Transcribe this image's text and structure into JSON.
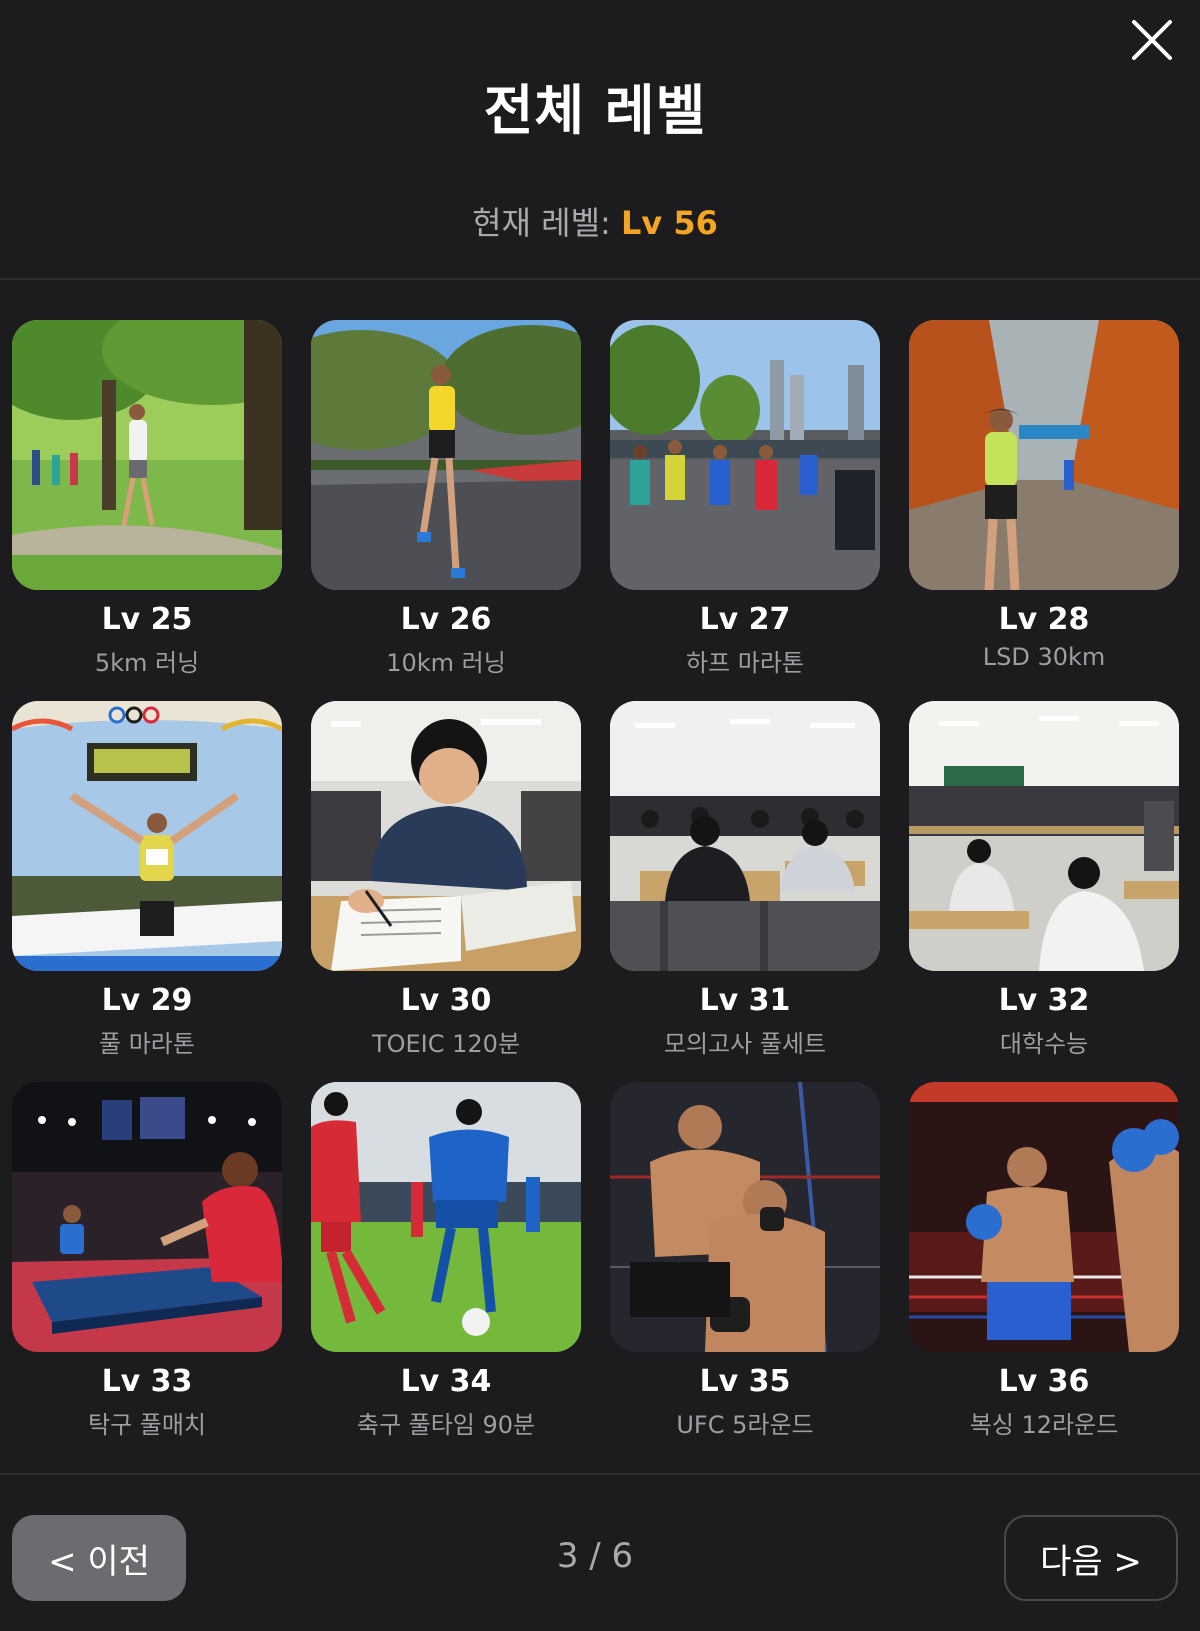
{
  "header": {
    "title": "전체 레벨",
    "current_level_label": "현재 레벨: ",
    "current_level_value": "Lv 56",
    "close_icon": "close-icon"
  },
  "levels": [
    {
      "level": "Lv 25",
      "name": "5km 러닝",
      "image": "park-running-image"
    },
    {
      "level": "Lv 26",
      "name": "10km 러닝",
      "image": "road-running-image"
    },
    {
      "level": "Lv 27",
      "name": "하프 마라톤",
      "image": "half-marathon-image"
    },
    {
      "level": "Lv 28",
      "name": "LSD 30km",
      "image": "autumn-running-image"
    },
    {
      "level": "Lv 29",
      "name": "풀 마라톤",
      "image": "marathon-finish-image"
    },
    {
      "level": "Lv 30",
      "name": "TOEIC 120분",
      "image": "toeic-study-image"
    },
    {
      "level": "Lv 31",
      "name": "모의고사 풀세트",
      "image": "mock-exam-image"
    },
    {
      "level": "Lv 32",
      "name": "대학수능",
      "image": "exam-hall-image"
    },
    {
      "level": "Lv 33",
      "name": "탁구 풀매치",
      "image": "table-tennis-image"
    },
    {
      "level": "Lv 34",
      "name": "축구 풀타임 90분",
      "image": "soccer-image"
    },
    {
      "level": "Lv 35",
      "name": "UFC 5라운드",
      "image": "ufc-fight-image"
    },
    {
      "level": "Lv 36",
      "name": "복싱 12라운드",
      "image": "boxing-image"
    }
  ],
  "footer": {
    "prev_label": "< 이전",
    "next_label": "다음 >",
    "page_indicator": "3 / 6"
  },
  "colors": {
    "background": "#1c1c1e",
    "accent": "#f5a524",
    "muted_text": "#9d9da2",
    "prev_button": "#6c6c70"
  }
}
